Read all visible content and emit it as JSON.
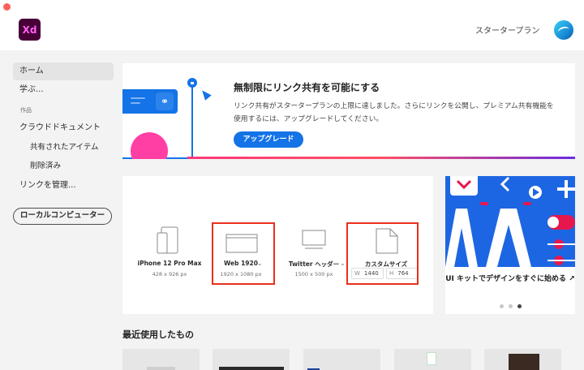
{
  "app": {
    "logo_text": "Xd",
    "plan_label": "スタータープラン"
  },
  "sidebar": {
    "items": [
      {
        "label": "ホーム"
      },
      {
        "label": "学ぶ..."
      },
      {
        "label": "クラウドドキュメント"
      },
      {
        "label": "共有されたアイテム"
      },
      {
        "label": "削除済み"
      },
      {
        "label": "リンクを管理..."
      }
    ],
    "section_label": "作品",
    "local_button": "ローカルコンピューター"
  },
  "banner": {
    "title": "無制限にリンク共有を可能にする",
    "text": "リンク共有がスタータープランの上限に達しました。さらにリンクを公開し、プレミアム共有機能を使用するには、アップグレードしてください。",
    "button": "アップグレード"
  },
  "presets": [
    {
      "name": "iPhone 12 Pro Max",
      "size": "428 x 926 px"
    },
    {
      "name": "Web 1920",
      "size": "1920 x 1080 px"
    },
    {
      "name": "Twitter ヘッダー",
      "size": "1500 x 500 px"
    },
    {
      "name": "カスタムサイズ",
      "w_label": "W",
      "w_value": "1440",
      "h_label": "H",
      "h_value": "764"
    }
  ],
  "ui_kit": {
    "text": "UI キットでデザインをすぐに始める",
    "art_letters": "AA"
  },
  "recent": {
    "title": "最近使用したもの"
  },
  "colors": {
    "accent": "#1473e6",
    "highlight": "#e8301c",
    "logo_bg": "#470137"
  }
}
